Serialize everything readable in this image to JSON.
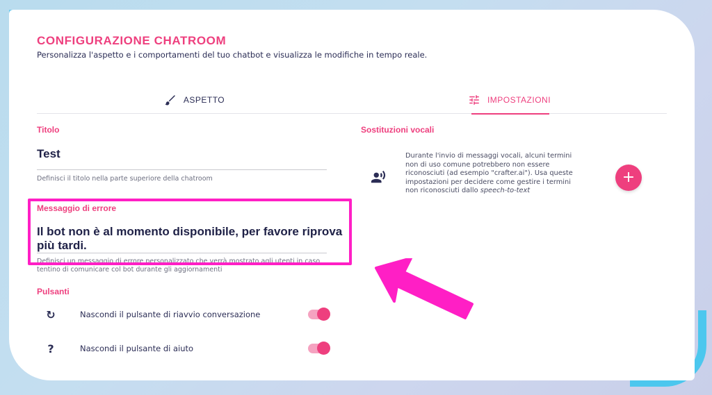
{
  "header": {
    "title": "CONFIGURAZIONE CHATROOM",
    "subtitle": "Personalizza l'aspetto e i comportamenti del tuo chatbot e visualizza le modifiche in tempo reale."
  },
  "tabs": [
    {
      "label": "ASPETTO",
      "icon": "brush-icon",
      "active": false
    },
    {
      "label": "IMPOSTAZIONI",
      "icon": "sliders-icon",
      "active": true
    }
  ],
  "title_field": {
    "label": "Titolo",
    "value": "Test",
    "hint": "Definisci il titolo nella parte superiore della chatroom"
  },
  "error_field": {
    "label": "Messaggio di errore",
    "value": "Il bot non è al momento disponibile, per favore riprova più tardi.",
    "hint": "Definisci un messaggio di errore personalizzato che verrà mostrato agli utenti in caso tentino di comunicare col bot durante gli aggiornamenti"
  },
  "buttons_section": {
    "label": "Pulsanti",
    "items": [
      {
        "icon": "restart-icon",
        "glyph": "↻",
        "label": "Nascondi il pulsante di riavvio conversazione",
        "enabled": true
      },
      {
        "icon": "help-icon",
        "glyph": "?",
        "label": "Nascondi il pulsante di aiuto",
        "enabled": true
      }
    ]
  },
  "voice_section": {
    "label": "Sostituzioni vocali",
    "description_main": "Durante l'invio di messaggi vocali, alcuni termini non di uso comune potrebbero non essere riconosciuti (ad esempio \"crafter.ai\"). Usa queste impostazioni per decidere come gestire i termini non riconosciuti dallo ",
    "description_em": "speech-to-text",
    "add_button": "+"
  },
  "colors": {
    "accent": "#ee3f7e",
    "text_dark": "#2b2d55",
    "highlight": "#ff1fc5"
  }
}
